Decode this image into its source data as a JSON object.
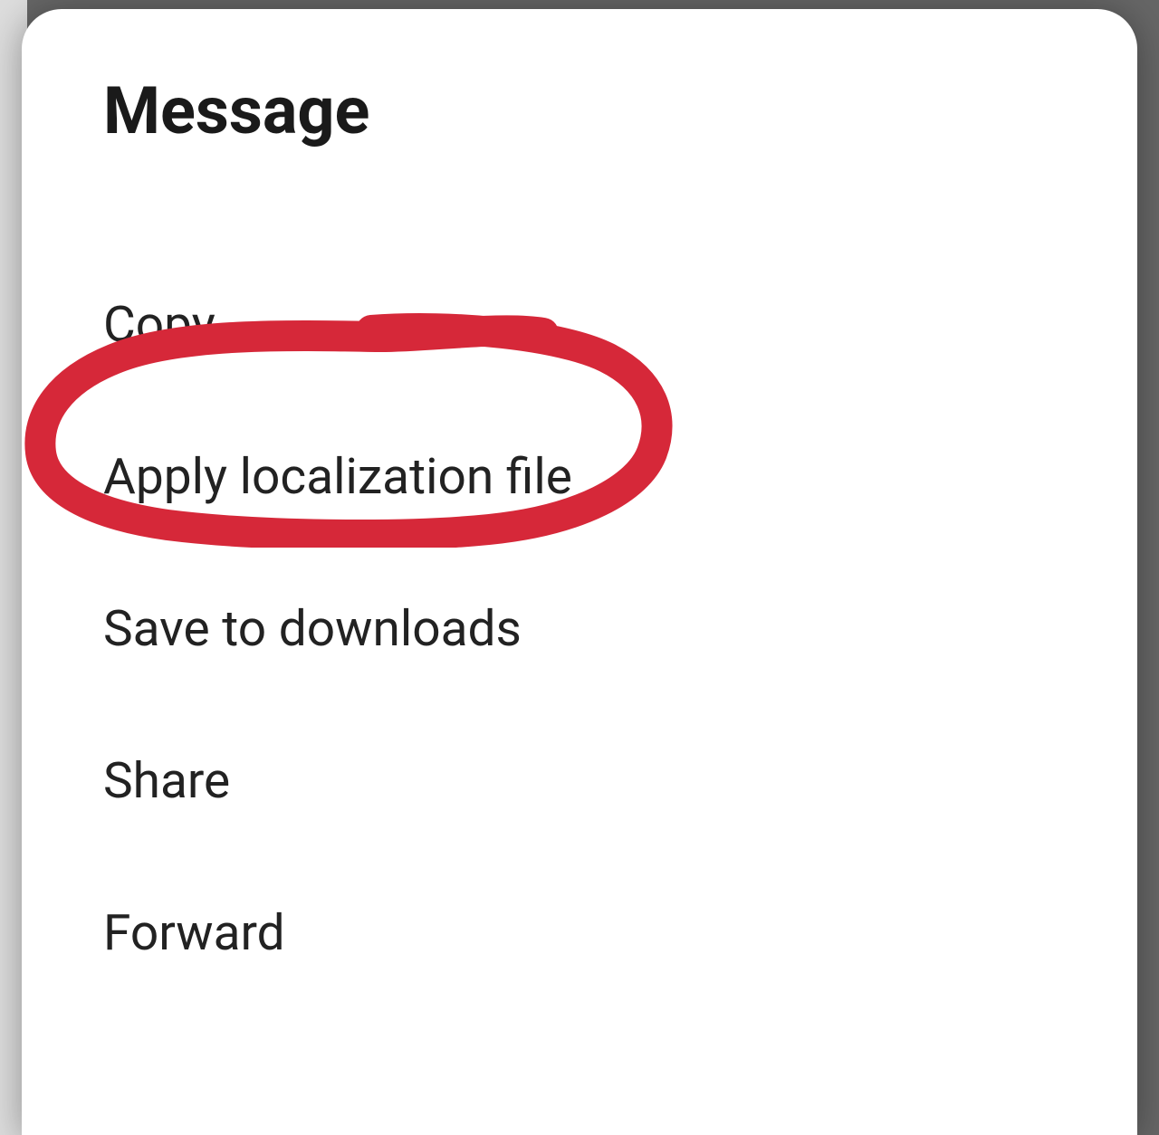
{
  "dialog": {
    "title": "Message",
    "menu_items": [
      "Copy",
      "Apply localization file",
      "Save to downloads",
      "Share",
      "Forward"
    ]
  },
  "annotation": {
    "highlighted_item_index": 1,
    "color": "#d62839"
  }
}
